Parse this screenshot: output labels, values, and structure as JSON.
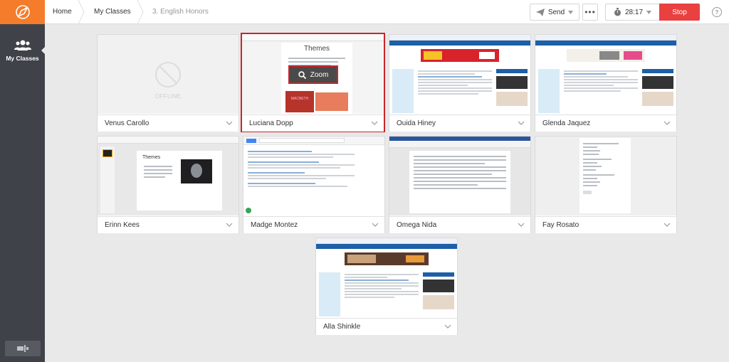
{
  "header": {
    "breadcrumbs": [
      "Home",
      "My Classes",
      "3. English Honors"
    ],
    "send_label": "Send",
    "more_label": "•••",
    "timer": "28:17",
    "stop_label": "Stop",
    "help_label": "?"
  },
  "sidebar": {
    "my_classes_label": "My Classes"
  },
  "students": [
    {
      "name": "Venus Carollo",
      "status": "OFFLINE"
    },
    {
      "name": "Luciana Dopp",
      "selected": true,
      "zoom_label": "Zoom",
      "doc_title": "Themes",
      "doc_caption": "MACBETH"
    },
    {
      "name": "Ouida Hiney"
    },
    {
      "name": "Glenda Jaquez"
    },
    {
      "name": "Erinn Kees",
      "doc_title": "Themes"
    },
    {
      "name": "Madge Montez"
    },
    {
      "name": "Omega Nida"
    },
    {
      "name": "Fay Rosato"
    },
    {
      "name": "Alla Shinkle"
    }
  ],
  "colors": {
    "accent": "#f47c2a",
    "stop": "#e94040",
    "sidebar": "#3f4349",
    "selected_border": "#c8262c"
  }
}
